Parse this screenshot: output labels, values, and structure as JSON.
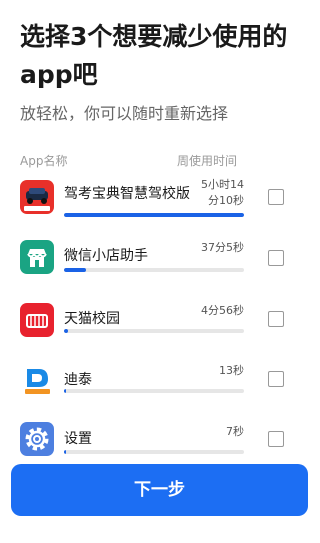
{
  "header": {
    "title": "选择3个想要减少使用的app吧",
    "subtitle": "放轻松，你可以随时重新选择"
  },
  "columns": {
    "app_name": "App名称",
    "weekly_time": "周使用时间"
  },
  "apps": [
    {
      "name": "驾考宝典智慧驾校版",
      "time": "5小时14分10秒",
      "usage_fraction": 1.0,
      "icon": "car-driving-app-icon",
      "checked": false
    },
    {
      "name": "微信小店助手",
      "time": "37分5秒",
      "usage_fraction": 0.12,
      "icon": "wechat-store-icon",
      "checked": false
    },
    {
      "name": "天猫校园",
      "time": "4分56秒",
      "usage_fraction": 0.02,
      "icon": "tmall-campus-icon",
      "checked": false
    },
    {
      "name": "迪泰",
      "time": "13秒",
      "usage_fraction": 0.01,
      "icon": "ditai-app-icon",
      "checked": false
    },
    {
      "name": "设置",
      "time": "7秒",
      "usage_fraction": 0.01,
      "icon": "settings-gear-icon",
      "checked": false
    }
  ],
  "footer": {
    "next_label": "下一步"
  },
  "colors": {
    "accent": "#1c6ef3",
    "bar_fill": "#1a62e6",
    "bar_track": "#e6e6e6"
  }
}
